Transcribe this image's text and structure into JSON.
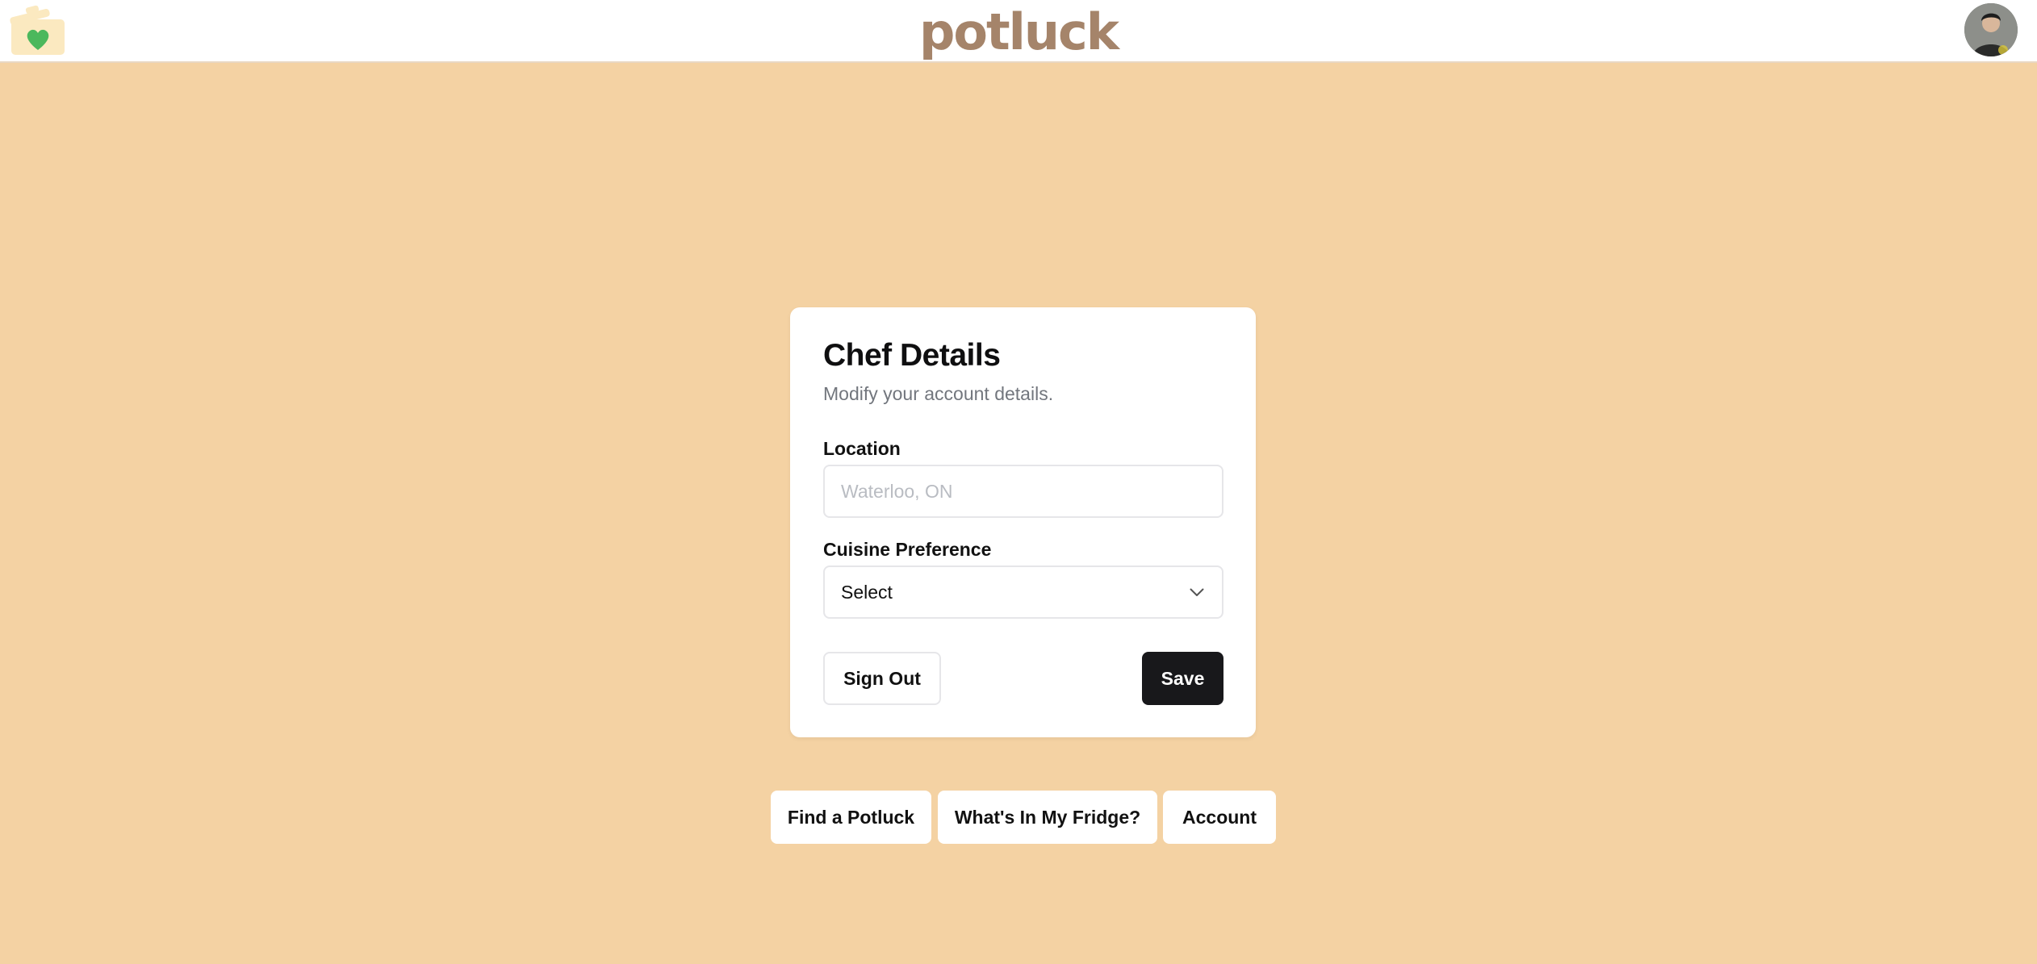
{
  "header": {
    "brand": "potluck",
    "logo_icon": "pot-heart-icon",
    "avatar_icon": "user-avatar"
  },
  "card": {
    "title": "Chef Details",
    "subtitle": "Modify your account details.",
    "location": {
      "label": "Location",
      "value": "",
      "placeholder": "Waterloo, ON"
    },
    "cuisine": {
      "label": "Cuisine Preference",
      "selected": "Select",
      "icon": "chevron-down-icon"
    },
    "sign_out_label": "Sign Out",
    "save_label": "Save"
  },
  "nav": {
    "find_label": "Find a Potluck",
    "fridge_label": "What's In My Fridge?",
    "account_label": "Account"
  },
  "colors": {
    "background": "#f4d2a3",
    "brand": "#a5846a",
    "save_button": "#18181b",
    "heart": "#4cb85c"
  }
}
